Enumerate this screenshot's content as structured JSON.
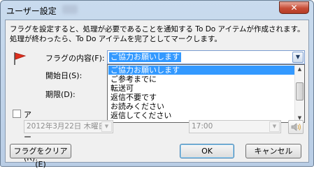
{
  "window": {
    "title": "ユーザー設定",
    "close_label": "✕"
  },
  "description": "フラグを設定すると、処理が必要であることを通知する To Do アイテムが作成されます。処理が終わったら、To Do アイテムを完了としてマークします。",
  "labels": {
    "flag_content": "フラグの内容(F):",
    "start_date": "開始日(S):",
    "due_date": "期限(D):",
    "alarm": "アラーム(R):"
  },
  "flag_combo": {
    "value": "ご協力お願いします"
  },
  "dropdown_items": [
    "ご協力お願いします",
    "ご参考までに",
    "転送可",
    "返信不要です",
    "お読みください",
    "返信してください"
  ],
  "alarm_date": "2012年3月22日 木曜日",
  "alarm_time": "17:00",
  "buttons": {
    "clear_flag": "フラグをクリア(E)",
    "ok": "OK",
    "cancel": "キャンセル"
  },
  "colors": {
    "selection": "#3399ff",
    "window_frame": "#b9cde5",
    "close_button": "#c74d37"
  }
}
